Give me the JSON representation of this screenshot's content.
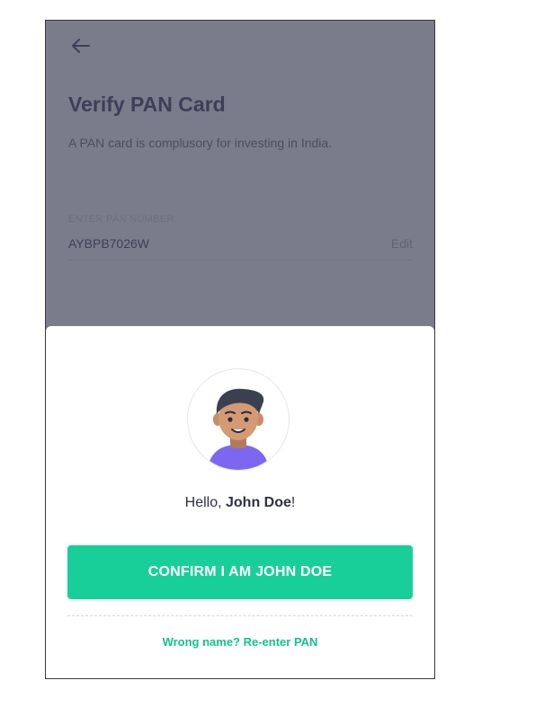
{
  "header": {
    "back_icon": "arrow-left-icon",
    "title": "Verify PAN Card",
    "subtitle": "A PAN card is complusory for investing in India."
  },
  "pan_field": {
    "label": "ENTER PAN NUMBER",
    "value": "AYBPB7026W",
    "edit_label": "Edit"
  },
  "confirm_sheet": {
    "avatar_icon": "user-avatar-icon",
    "greeting_prefix": "Hello, ",
    "user_name": "John Doe",
    "greeting_suffix": "!",
    "confirm_label": "CONFIRM I AM JOHN DOE",
    "reenter_label": "Wrong name? Re-enter PAN"
  },
  "colors": {
    "overlay": "#7b7c8b",
    "primary": "#19cf99",
    "link": "#12c28f",
    "title_text": "#3b3f58",
    "sheet_background": "#ffffff"
  }
}
